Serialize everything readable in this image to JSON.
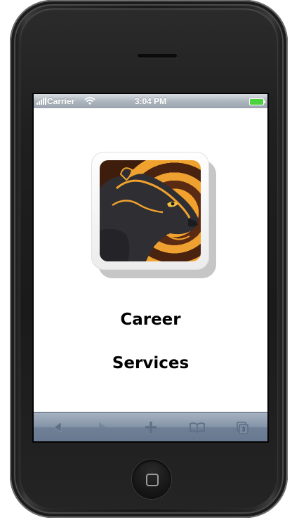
{
  "status_bar": {
    "carrier": "Carrier",
    "time": "3:04 PM",
    "battery_color": "#4cd23c"
  },
  "app": {
    "icon": "panther-app-icon",
    "label_line1": "Career",
    "label_line2": "Services"
  },
  "toolbar": {
    "items": [
      "back-arrow-icon",
      "forward-arrow-icon",
      "add-plus-icon",
      "bookmarks-book-icon",
      "pages-icon"
    ],
    "pages_count": "3"
  }
}
